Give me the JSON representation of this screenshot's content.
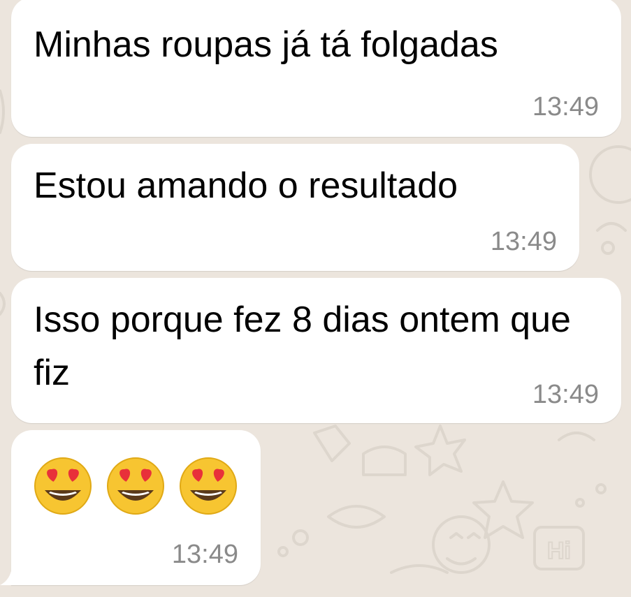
{
  "messages": [
    {
      "text": "Minhas roupas já tá folgadas",
      "time": "13:49"
    },
    {
      "text": "Estou amando o resultado",
      "time": "13:49"
    },
    {
      "text": "Isso porque fez 8 dias ontem que fiz",
      "time": "13:49"
    },
    {
      "emojis": [
        "smiling-face-with-heart-eyes",
        "smiling-face-with-heart-eyes",
        "smiling-face-with-heart-eyes"
      ],
      "time": "13:49"
    }
  ],
  "wallpaper_badge": "Hi",
  "colors": {
    "background": "#ece5dd",
    "bubble": "#ffffff",
    "timestamp": "#8a8a8a",
    "emoji_face": "#f7c531",
    "emoji_heart": "#e8313a"
  }
}
